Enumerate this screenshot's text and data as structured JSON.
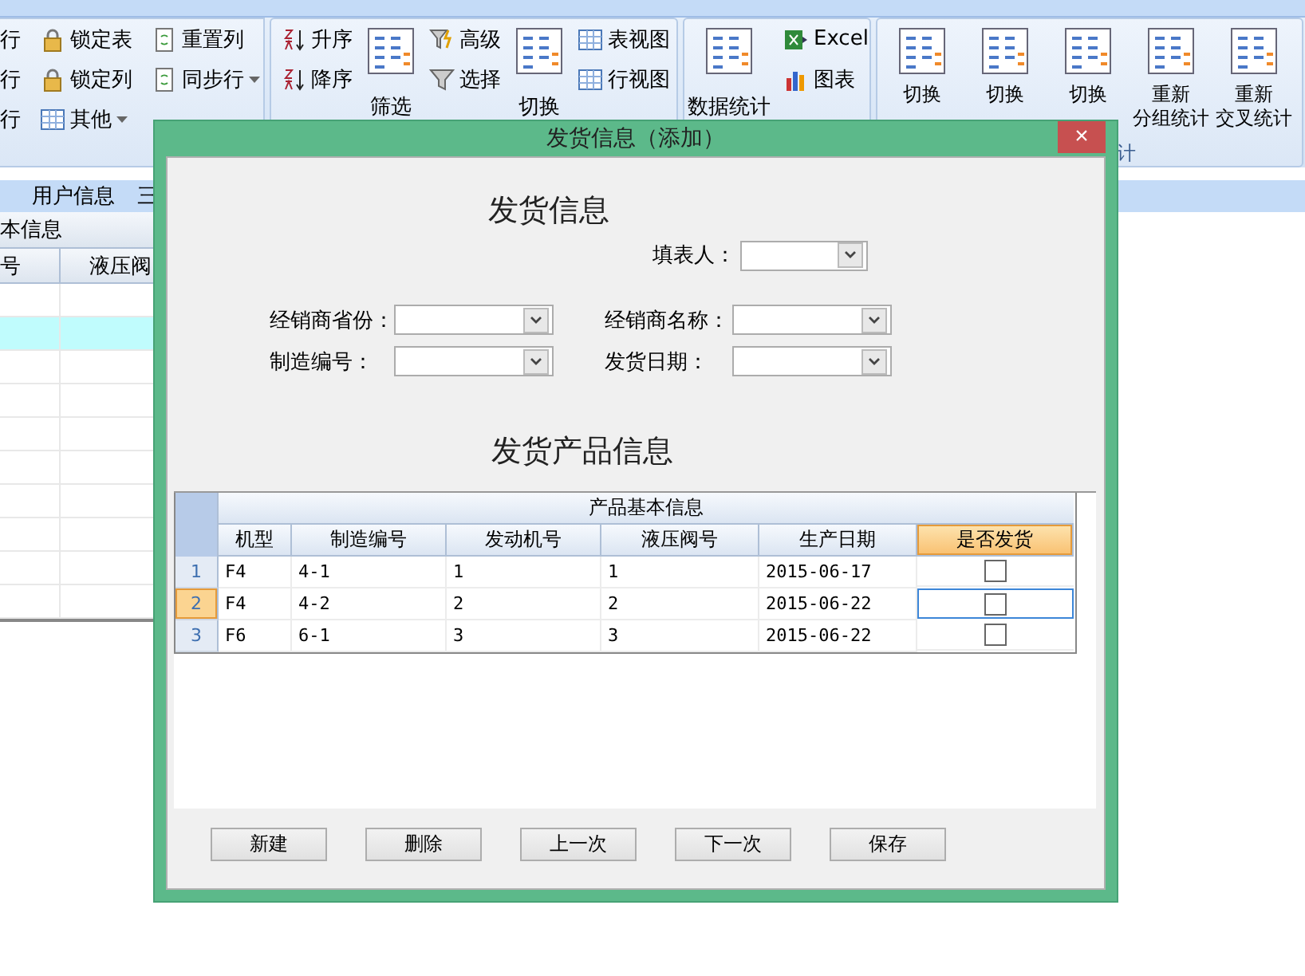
{
  "ribbon": {
    "groups": [
      {
        "columns": [
          {
            "kind": "small",
            "items": [
              {
                "label": "行",
                "dropdown": false
              },
              {
                "label": "行",
                "dropdown": false
              },
              {
                "label": "行",
                "dropdown": false
              }
            ]
          },
          {
            "kind": "small",
            "items": [
              {
                "label": "锁定表",
                "dropdown": false
              },
              {
                "label": "锁定列",
                "dropdown": false
              },
              {
                "label": "其他",
                "dropdown": true
              }
            ]
          },
          {
            "kind": "small",
            "items": [
              {
                "label": "重置列",
                "dropdown": false
              },
              {
                "label": "同步行",
                "dropdown": true
              }
            ]
          }
        ]
      },
      {
        "columns": [
          {
            "kind": "small",
            "items": [
              {
                "label": "升序",
                "dropdown": false
              },
              {
                "label": "降序",
                "dropdown": false
              }
            ]
          },
          {
            "kind": "big",
            "label": "筛选"
          },
          {
            "kind": "small",
            "items": [
              {
                "label": "高级",
                "dropdown": false
              },
              {
                "label": "选择",
                "dropdown": false
              }
            ]
          },
          {
            "kind": "big",
            "label": "切换"
          },
          {
            "kind": "small",
            "items": [
              {
                "label": "表视图",
                "dropdown": false
              },
              {
                "label": "行视图",
                "dropdown": false
              }
            ]
          }
        ]
      },
      {
        "columns": [
          {
            "kind": "big",
            "label": "数据统计"
          },
          {
            "kind": "small",
            "items": [
              {
                "label": "Excel",
                "dropdown": false
              },
              {
                "label": "图表",
                "dropdown": false
              }
            ]
          }
        ]
      },
      {
        "caption": "计",
        "columns": [
          {
            "kind": "big",
            "label": "切换"
          },
          {
            "kind": "big",
            "label": "切换"
          },
          {
            "kind": "big",
            "label": "切换"
          },
          {
            "kind": "big",
            "label": "重新",
            "label2": "分组统计"
          },
          {
            "kind": "big",
            "label": "重新",
            "label2": "交叉统计"
          }
        ]
      }
    ]
  },
  "tabs": [
    {
      "label": "用户信息",
      "selected": false
    },
    {
      "label": "三",
      "selected": false
    }
  ],
  "back_grid": {
    "band": "本信息",
    "columns": [
      "号",
      "液压阀"
    ],
    "rows": [
      {
        "selected": false
      },
      {
        "selected": true
      },
      {
        "selected": false
      },
      {
        "selected": false
      },
      {
        "selected": false
      },
      {
        "selected": false
      },
      {
        "selected": false
      },
      {
        "selected": false
      },
      {
        "selected": false
      },
      {
        "selected": false
      }
    ]
  },
  "dialog": {
    "title": "发货信息（添加）",
    "close": "×",
    "heading": "发货信息",
    "filler": {
      "label": "填表人："
    },
    "fields": [
      {
        "label": "经销商省份："
      },
      {
        "label": "经销商名称："
      },
      {
        "label": "制造编号："
      },
      {
        "label": "发货日期："
      }
    ],
    "products_heading": "发货产品信息",
    "grid": {
      "band": "产品基本信息",
      "columns": [
        {
          "label": "机型",
          "selected": false
        },
        {
          "label": "制造编号",
          "selected": false
        },
        {
          "label": "发动机号",
          "selected": false
        },
        {
          "label": "液压阀号",
          "selected": false
        },
        {
          "label": "生产日期",
          "selected": false
        },
        {
          "label": "是否发货",
          "selected": true
        }
      ],
      "rows": [
        {
          "number": "1",
          "selected": false,
          "cells": [
            "F4",
            "4-1",
            "1",
            "1",
            "2015-06-17"
          ],
          "shipped": false
        },
        {
          "number": "2",
          "selected": true,
          "cells": [
            "F4",
            "4-2",
            "2",
            "2",
            "2015-06-22"
          ],
          "shipped": false
        },
        {
          "number": "3",
          "selected": false,
          "cells": [
            "F6",
            "6-1",
            "3",
            "3",
            "2015-06-22"
          ],
          "shipped": false
        }
      ]
    },
    "buttons": [
      "新建",
      "删除",
      "上一次",
      "下一次",
      "保存"
    ]
  }
}
